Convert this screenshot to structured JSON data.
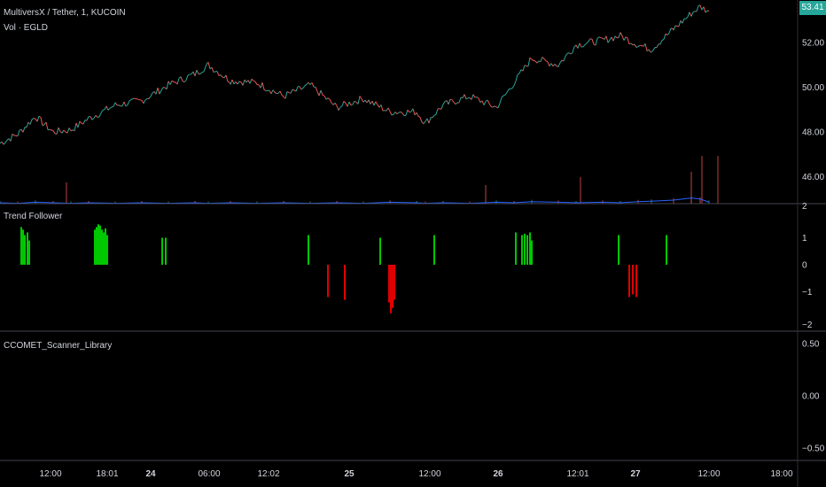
{
  "chart_data": [
    {
      "pane": "price",
      "type": "line",
      "title": "MultiversX / Tether, 1, KUCOIN",
      "volume_label": "Vol · EGLD",
      "last_price": "53.41",
      "ylim": [
        44.8,
        53.9
      ],
      "y_ticks": [
        "52.00",
        "50.00",
        "48.00",
        "46.00"
      ],
      "x": [
        0,
        20,
        40,
        60,
        80,
        100,
        130,
        160,
        190,
        220,
        235,
        260,
        290,
        320,
        350,
        380,
        410,
        440,
        470,
        480,
        500,
        530,
        560,
        580,
        600,
        630,
        650,
        680,
        700,
        720,
        735,
        760,
        780,
        790,
        800
      ],
      "y": [
        47.5,
        47.9,
        48.7,
        48.0,
        48.1,
        48.6,
        49.2,
        49.4,
        50.1,
        50.6,
        51.0,
        50.3,
        50.2,
        49.6,
        50.1,
        49.1,
        49.5,
        48.9,
        48.9,
        48.4,
        49.2,
        49.6,
        49.1,
        50.2,
        51.3,
        51.0,
        51.9,
        52.1,
        52.3,
        51.9,
        51.7,
        52.6,
        53.3,
        53.6,
        53.4
      ],
      "volume": [
        0.05,
        0.04,
        0.06,
        0.05,
        0.04,
        0.05,
        0.04,
        0.05,
        0.04,
        0.05,
        0.04,
        0.05,
        0.04,
        0.05,
        0.04,
        0.05,
        0.04,
        0.06,
        0.05,
        0.04,
        0.05,
        0.04,
        0.06,
        0.05,
        0.07,
        0.06,
        0.05,
        0.06,
        0.05,
        0.07,
        0.08,
        0.1,
        0.14,
        0.12,
        0.06
      ],
      "colors": {
        "up": "#26a69a",
        "down": "#ef5350",
        "volume_line": "#2962ff",
        "badge": "#26a69a"
      }
    },
    {
      "pane": "indicator",
      "type": "bar",
      "title": "Trend Follower",
      "ylim": [
        -2.2,
        2.2
      ],
      "y_ticks": [
        "2",
        "1",
        "0",
        "−1",
        "−2"
      ],
      "x": [
        24,
        26,
        28,
        31,
        33,
        107,
        109,
        111,
        113,
        115,
        117,
        119,
        121,
        183,
        187,
        348,
        370,
        389,
        429,
        439,
        441,
        443,
        445,
        490,
        582,
        589,
        592,
        595,
        598,
        600,
        698,
        710,
        714,
        718,
        752
      ],
      "values": [
        1.4,
        1.3,
        1.1,
        1.2,
        0.9,
        1.3,
        1.4,
        1.5,
        1.45,
        1.3,
        1.2,
        1.35,
        1.1,
        1.0,
        1.0,
        1.1,
        -1.2,
        -1.3,
        1.0,
        -1.4,
        -1.8,
        -1.6,
        -1.3,
        1.1,
        1.2,
        1.1,
        1.15,
        1.1,
        1.2,
        0.9,
        1.1,
        -1.2,
        -1.1,
        -1.2,
        1.1
      ],
      "colors": {
        "positive": "#00c800",
        "negative": "#e00000"
      }
    },
    {
      "pane": "scanner",
      "type": "line",
      "title": "CCOMET_Scanner_Library",
      "ylim": [
        -0.6,
        0.6
      ],
      "y_ticks": [
        "0.50",
        "0.00",
        "−0.50"
      ]
    }
  ],
  "time_axis": [
    "12:00",
    "18:01",
    "24",
    "06:00",
    "12:02",
    "25",
    "12:00",
    "26",
    "12:01",
    "27",
    "12:00",
    "18:00"
  ],
  "time_axis_bold": [
    false,
    false,
    true,
    false,
    false,
    true,
    false,
    true,
    false,
    true,
    false,
    false
  ],
  "colors": {
    "background": "#000000",
    "text": "#d1d4dc",
    "separator": "#2a2e39"
  }
}
